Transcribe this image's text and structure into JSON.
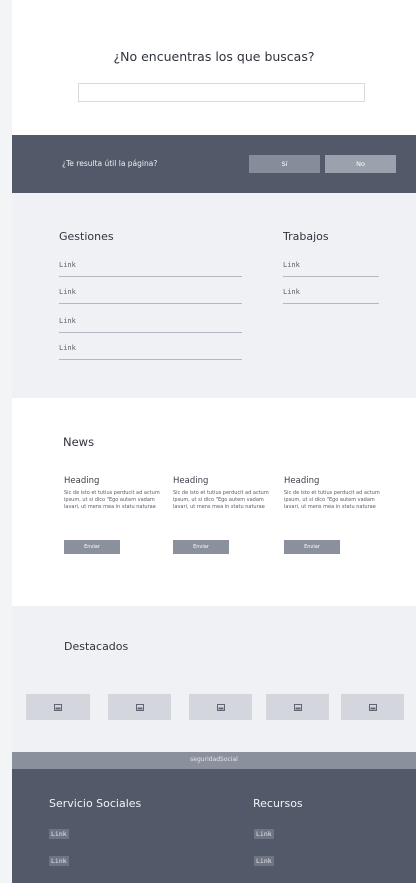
{
  "search": {
    "title": "¿No encuentras los que buscas?",
    "input_value": "",
    "input_placeholder": ""
  },
  "feedback": {
    "question": "¿Te resulta útil la página?",
    "yes_label": "Sí",
    "no_label": "No"
  },
  "quick_links": {
    "gestiones": {
      "heading": "Gestiones",
      "links": [
        "Link",
        "Link",
        "Link",
        "Link"
      ]
    },
    "trabajos": {
      "heading": "Trabajos",
      "links": [
        "Link",
        "Link"
      ]
    }
  },
  "news": {
    "title": "News",
    "cards": [
      {
        "heading": "Heading",
        "body": "Sic de isto et tutius perducit ad actum ipsum, ut si dico \"Ego autem vadam lavari, ut mens mea in statu naturae",
        "button": "Enviar"
      },
      {
        "heading": "Heading",
        "body": "Sic de isto et tutius perducit ad actum ipsum, ut si dico \"Ego autem vadam lavari, ut mens mea in statu naturae",
        "button": "Enviar"
      },
      {
        "heading": "Heading",
        "body": "Sic de isto et tutius perducit ad actum ipsum, ut si dico \"Ego autem vadam lavari, ut mens mea in statu naturae",
        "button": "Enviar"
      }
    ]
  },
  "featured": {
    "title": "Destacados",
    "item_count_icons": [
      "image-icon",
      "image-icon",
      "image-icon",
      "image-icon",
      "image-icon"
    ]
  },
  "brand": {
    "text": "seguridadSocial"
  },
  "footer": {
    "servicios": {
      "heading": "Servicio Sociales",
      "links": [
        "Link",
        "Link"
      ]
    },
    "recursos": {
      "heading": "Recursos",
      "links": [
        "Link",
        "Link"
      ]
    }
  },
  "colors": {
    "dark_band": "#525a69",
    "light_band": "#eff1f4",
    "button_gray": "#8a909c"
  }
}
